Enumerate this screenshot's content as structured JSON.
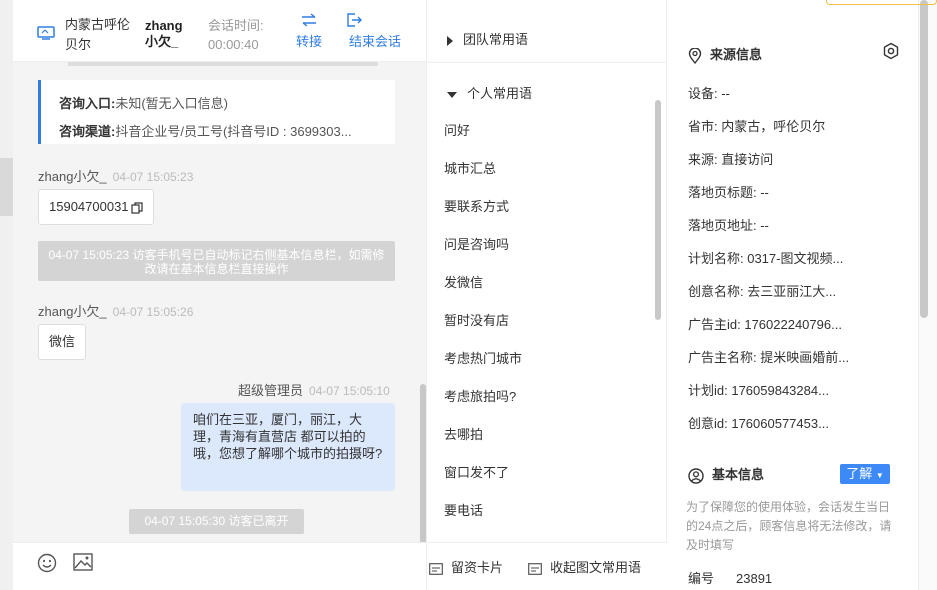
{
  "header": {
    "location": "内蒙古呼伦贝尔",
    "visitor_name": "zhang小欠_",
    "time_label": "会话时间:",
    "time_value": "00:00:40",
    "transfer_label": "转接",
    "end_label": "结束会话"
  },
  "info_card": {
    "entry_label": "咨询入口:",
    "entry_value": "未知(暂无入口信息)",
    "channel_label": "咨询渠道:",
    "channel_value": "抖音企业号/员工号(抖音号ID : 3699303..."
  },
  "messages": [
    {
      "sender": "zhang小欠_",
      "time": "04-07 15:05:23",
      "text": "15904700031"
    },
    {
      "system": "04-07 15:05:23 访客手机号已自动标记右侧基本信息栏，如需修改请在基本信息栏直接操作"
    },
    {
      "sender": "zhang小欠_",
      "time": "04-07 15:05:26",
      "text": "微信"
    },
    {
      "sender": "超级管理员",
      "time": "04-07 15:05:10",
      "text": "咱们在三亚，厦门，丽江，大理，青海有直营店 都可以拍的哦，您想了解哪个城市的拍摄呀?"
    },
    {
      "system": "04-07 15:05:30 访客已离开"
    }
  ],
  "phrases": {
    "team_group": "团队常用语",
    "personal_group": "个人常用语",
    "items": [
      "问好",
      "城市汇总",
      "要联系方式",
      "问是咨询吗",
      "发微信",
      "暂时没有店",
      "考虑热门城市",
      "考虑旅拍吗?",
      "去哪拍",
      "窗口发不了",
      "要电话"
    ],
    "footer_card": "留资卡片",
    "footer_collapse": "收起图文常用语"
  },
  "source_info": {
    "title": "来源信息",
    "fields": [
      "设备: --",
      "省市: 内蒙古，呼伦贝尔",
      "来源: 直接访问",
      "落地页标题: --",
      "落地页地址: --",
      "计划名称: 0317-图文视频...",
      "创意名称: 去三亚丽江大...",
      "广告主id: 176022240796...",
      "广告主名称: 提米映画婚前...",
      "计划id: 176059843284...",
      "创意id: 176060577453..."
    ]
  },
  "basic_info": {
    "title": "基本信息",
    "learn_label": "了解",
    "notice": "为了保障您的使用体验，会话发生当日的24点之后，顾客信息将无法修改，请及时填写",
    "number_label": "编号",
    "number_value": "23891"
  },
  "colors": {
    "accent": "#2f7de1",
    "button_blue": "#3d8af7",
    "outgoing_bubble": "#dce8fc",
    "system_note": "#d4d4d4"
  }
}
